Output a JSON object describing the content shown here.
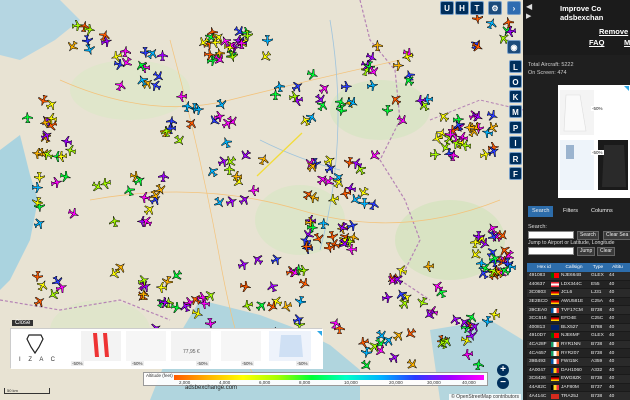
{
  "map": {
    "top_buttons": [
      "U",
      "H",
      "T"
    ],
    "side_buttons": [
      "L",
      "O",
      "K",
      "M",
      "P",
      "I",
      "R",
      "F"
    ],
    "zoom_in": "+",
    "zoom_out": "−",
    "attribution": "© OpenStreetMap contributors",
    "brand": "adsbexchange.com",
    "scale_label": "50 km",
    "altitude_legend": {
      "title": "Altitude (feet)",
      "ticks": [
        "2,000",
        "4,000",
        "6,000",
        "8,000",
        "10,000",
        "20,000",
        "30,000",
        "40,000"
      ]
    },
    "plane_colors": [
      "#ff00ff",
      "#a000ff",
      "#2a3cff",
      "#00b4ff",
      "#00ff36",
      "#a7ff00",
      "#ffff00",
      "#ffb400",
      "#ff5a00"
    ]
  },
  "ad_banner": {
    "close_label": "Close",
    "brand_letters": "I Z A C",
    "price": "77,95 €",
    "discounts": [
      "-50%",
      "-50%",
      "-50%",
      "-50%",
      "-50%"
    ]
  },
  "sidebar": {
    "promo_line1": "Improve Co",
    "promo_line2": "adsbexchan",
    "remove_link": "Remove",
    "faq_link": "FAQ",
    "map_link": "M",
    "total_aircraft": "Total Aircraft: 5222",
    "on_screen": "On Screen: 474",
    "sb_ad_discounts": [
      "-50%",
      "-50%"
    ],
    "tabs": [
      "Search",
      "Filters",
      "Columns"
    ],
    "search_label": "Search:",
    "search_button": "Search",
    "clear_search_button": "Clear Sea",
    "jump_label": "Jump to Airport or Latitude, Longitude",
    "jump_button": "Jump",
    "clear_button": "Clear",
    "table": {
      "headers": [
        "Hex id",
        "Callsign",
        "Type",
        "Altitu"
      ],
      "rows": [
        {
          "hex": "491083",
          "flag": "pt",
          "callsign": "NJE664B",
          "type": "GLEX",
          "alt": "44"
        },
        {
          "hex": "440637",
          "flag": "at",
          "callsign": "LDX344C",
          "type": "E55",
          "alt": "40"
        },
        {
          "hex": "3C0803",
          "flag": "de",
          "callsign": "JCL6",
          "type": "LJ31",
          "alt": "40"
        },
        {
          "hex": "3E2BCD",
          "flag": "de",
          "callsign": "AWU581E",
          "type": "C25A",
          "alt": "40"
        },
        {
          "hex": "39CEA0",
          "flag": "fr",
          "callsign": "TVF17CM",
          "type": "B738",
          "alt": "40"
        },
        {
          "hex": "3CC616",
          "flag": "de",
          "callsign": "EFD4E",
          "type": "C25C",
          "alt": "40"
        },
        {
          "hex": "400813",
          "flag": "gb",
          "callsign": "BLX527",
          "type": "B788",
          "alt": "40"
        },
        {
          "hex": "4910D7",
          "flag": "pt",
          "callsign": "NJE6MF",
          "type": "GLEX",
          "alt": "40"
        },
        {
          "hex": "4CA28F",
          "flag": "ie",
          "callsign": "RYR1NN",
          "type": "B738",
          "alt": "40"
        },
        {
          "hex": "4CA657",
          "flag": "ie",
          "callsign": "RYR207",
          "type": "B738",
          "alt": "40"
        },
        {
          "hex": "39B493",
          "flag": "fr",
          "callsign": "FWI15K",
          "type": "A359",
          "alt": "40"
        },
        {
          "hex": "4A0047",
          "flag": "ro",
          "callsign": "DAH1060",
          "type": "A332",
          "alt": "40"
        },
        {
          "hex": "3C6426",
          "flag": "de",
          "callsign": "EWG8ZK",
          "type": "B738",
          "alt": "40"
        },
        {
          "hex": "44A82C",
          "flag": "be",
          "callsign": "JAF80M",
          "type": "B737",
          "alt": "40"
        },
        {
          "hex": "4A414C",
          "flag": "ch",
          "callsign": "TRA25J",
          "type": "B738",
          "alt": "40"
        },
        {
          "hex": "39AB7B",
          "flag": "fr",
          "callsign": "KLM59V",
          "type": "E190",
          "alt": "40"
        }
      ]
    }
  }
}
